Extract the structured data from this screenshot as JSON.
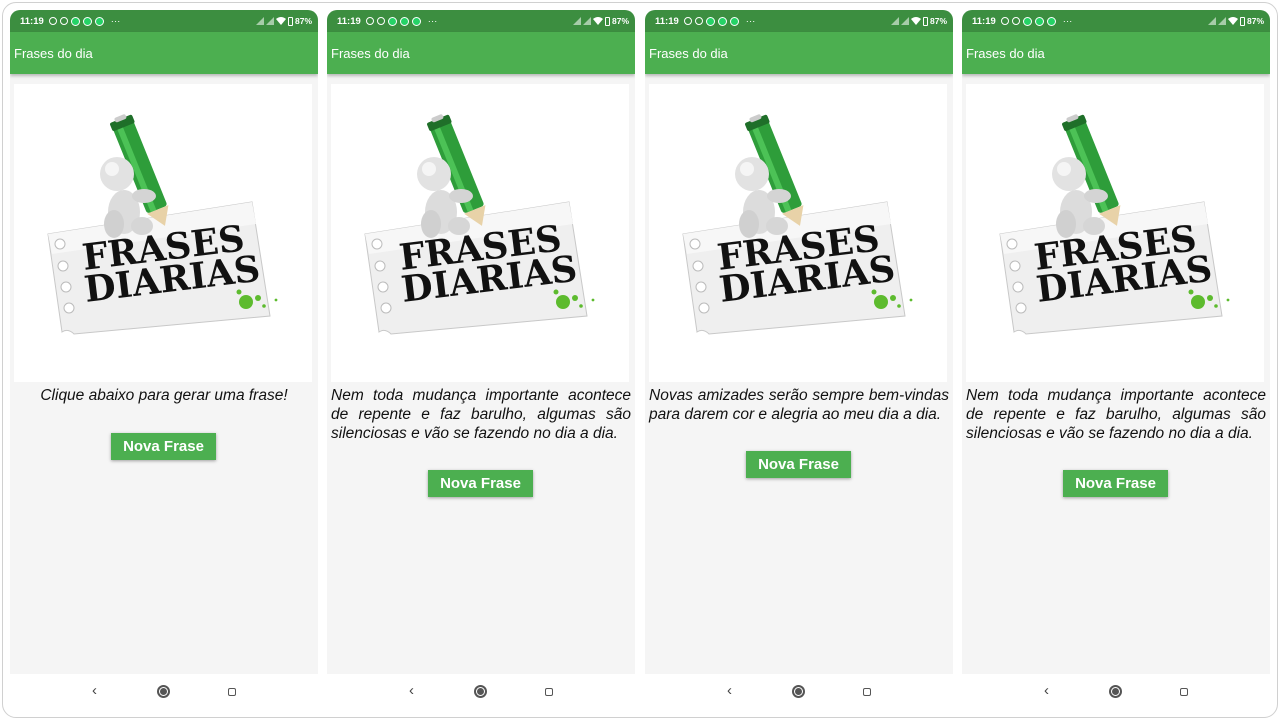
{
  "status": {
    "time": "11:19",
    "battery": "87%",
    "more": "···"
  },
  "app": {
    "title": "Frases do dia"
  },
  "logo": {
    "line1": "FRASES",
    "line2": "DIARIAS"
  },
  "button": {
    "label": "Nova Frase"
  },
  "screens": [
    {
      "phrase": "Clique abaixo para gerar uma frase!"
    },
    {
      "phrase": "Nem toda mudança importante acontece de repente e faz barulho, algumas são silenciosas e vão se fazendo no dia a dia."
    },
    {
      "phrase": "Novas amizades serão sempre bem-vindas para darem cor e alegria ao meu dia a dia."
    },
    {
      "phrase": "Nem toda mudança importante acontece de repente e faz barulho, algumas são silenciosas e vão se fazendo no dia a dia."
    }
  ],
  "colors": {
    "status": "#3c8e40",
    "appbar": "#4caf50",
    "button": "#4caf50",
    "screen": "#f5f5f5"
  }
}
